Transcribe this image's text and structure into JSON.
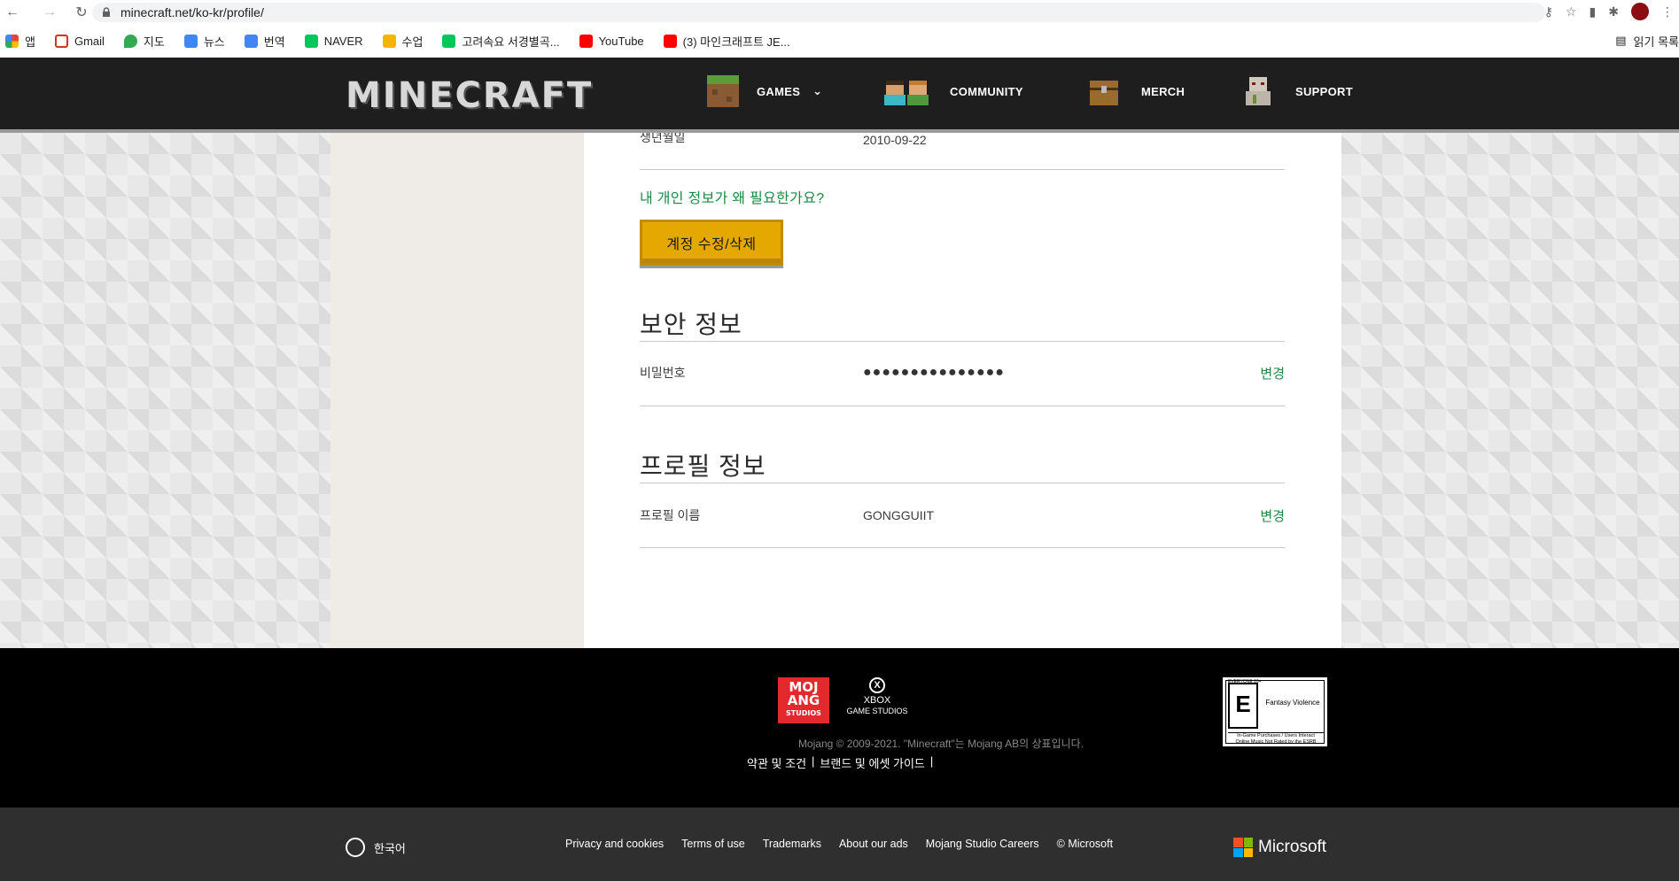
{
  "browser": {
    "url": "minecraft.net/ko-kr/profile/",
    "bookmarks": [
      {
        "label": "앱",
        "color": "#ea4335"
      },
      {
        "label": "Gmail",
        "color": "#d93025"
      },
      {
        "label": "지도",
        "color": "#34a853"
      },
      {
        "label": "뉴스",
        "color": "#4285f4"
      },
      {
        "label": "번역",
        "color": "#4285f4"
      },
      {
        "label": "NAVER",
        "color": "#03c75a"
      },
      {
        "label": "수업",
        "color": "#f4b400"
      },
      {
        "label": "고려속요 서경별곡...",
        "color": "#03c75a"
      },
      {
        "label": "YouTube",
        "color": "#ff0000"
      },
      {
        "label": "(3) 마인크래프트 JE...",
        "color": "#ff0000"
      }
    ],
    "reading_list": "읽기 목록"
  },
  "header": {
    "logo": "MINECRAFT",
    "nav": [
      {
        "label": "GAMES",
        "icon": "grass-block-icon",
        "has_dropdown": true
      },
      {
        "label": "COMMUNITY",
        "icon": "players-icon"
      },
      {
        "label": "MERCH",
        "icon": "chest-icon"
      },
      {
        "label": "SUPPORT",
        "icon": "iron-golem-icon"
      }
    ]
  },
  "profile": {
    "birthdate_label": "생년월일",
    "birthdate_value": "2010-09-22",
    "why_link": "내 개인 정보가 왜 필요한가요?",
    "edit_button": "계정 수정/삭제",
    "security_title": "보안 정보",
    "password_label": "비밀번호",
    "password_value": "●●●●●●●●●●●●●●●",
    "password_action": "변경",
    "profile_title": "프로필 정보",
    "profile_name_label": "프로필 이름",
    "profile_name_value": "GONGGUIIT",
    "profile_action": "변경"
  },
  "footer": {
    "mojang": "MOJANG",
    "mojang_sub": "STUDIOS",
    "xbox": "XBOX",
    "xbox_sub": "GAME STUDIOS",
    "copyright": "Mojang © 2009-2021. \"Minecraft\"는 Mojang AB의 상표입니다.",
    "legal": [
      "약관 및 조건",
      "브랜드 및 에셋 가이드"
    ],
    "esrb_rating": "E",
    "esrb_top": "EVERYONE 10+",
    "esrb_descriptor": "Fantasy Violence",
    "esrb_fine1": "In-Game Purchases / Users Interact",
    "esrb_fine2": "Online Music Not Rated by the ESRB",
    "language": "한국어",
    "links": [
      "Privacy and cookies",
      "Terms of use",
      "Trademarks",
      "About our ads",
      "Mojang Studio Careers",
      "© Microsoft"
    ],
    "microsoft": "Microsoft"
  }
}
